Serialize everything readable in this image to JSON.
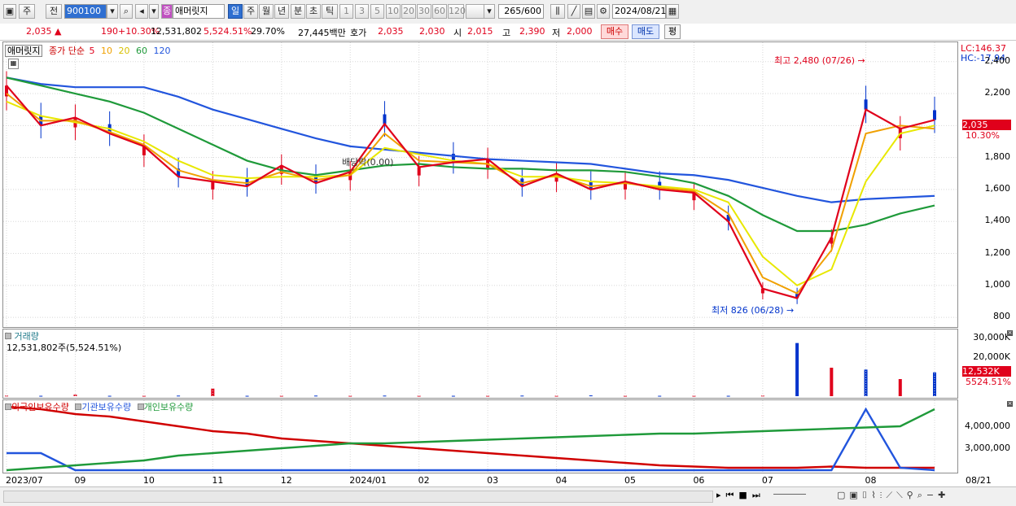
{
  "toolbar": {
    "market": "주",
    "market2": "전",
    "code": "900100",
    "stock_name": "애머릿지",
    "periods": [
      "일",
      "주",
      "월",
      "년",
      "분",
      "초",
      "틱"
    ],
    "active_period": "일",
    "minute_options": [
      "1",
      "3",
      "5",
      "10",
      "20",
      "30",
      "60",
      "120"
    ],
    "count": "265",
    "count_total": "/600",
    "date": "2024/08/21"
  },
  "quote": {
    "price": "2,035",
    "change": "190",
    "change_pct": "+10.30%",
    "volume": "12,531,802",
    "volume_pct": "5,524.51%",
    "turnover": "29.70%",
    "amount": "27,445백만",
    "ask_label": "호가",
    "ask": "2,035",
    "bid": "2,030",
    "open_label": "시",
    "open": "2,015",
    "high_label": "고",
    "high": "2,390",
    "low_label": "저",
    "low": "2,000",
    "buy_label": "매수",
    "sell_label": "매도",
    "eval_label": "평"
  },
  "price_panel": {
    "title_tag": "애머릿지",
    "ma_label": "종가 단순",
    "ma_periods": [
      "5",
      "10",
      "20",
      "60",
      "120"
    ],
    "ma_colors": [
      "#e0001b",
      "#f0a000",
      "#e8e800",
      "#1f9a3a",
      "#2255dd"
    ],
    "lc": "LC:146.37",
    "hc": "HC:-17.94",
    "high_annot": "최고 2,480 (07/26)",
    "low_annot": "최저 826 (06/28)",
    "event_annot": "배당락(0.00)",
    "last_price": "2,035",
    "last_pct": "10.30%",
    "y_ticks": [
      "2,400",
      "2,200",
      "2,000",
      "1,800",
      "1,600",
      "1,400",
      "1,200",
      "1,000",
      "800"
    ]
  },
  "volume_panel": {
    "title": "거래량",
    "value": "12,531,802주(5,524.51%)",
    "y_ticks": [
      "30,000K",
      "20,000K"
    ],
    "last_volume": "12,532K",
    "last_pct": "5524.51%"
  },
  "holding_panel": {
    "series_labels": [
      "외국인보유수량",
      "기관보유수량",
      "개인보유수량"
    ],
    "series_colors": [
      "#d00000",
      "#2255dd",
      "#1f9a3a"
    ],
    "y_ticks": [
      "4,000,000",
      "3,000,000"
    ]
  },
  "x_axis": {
    "labels": [
      "2023/07",
      "09",
      "10",
      "11",
      "12",
      "2024/01",
      "02",
      "03",
      "04",
      "05",
      "06",
      "07",
      "08"
    ],
    "end_label": "08/21"
  },
  "chart_data": {
    "type": "line",
    "title": "애머릿지",
    "ylim": [
      760,
      2480
    ],
    "series": [
      {
        "name": "5",
        "values": [
          2250,
          2000,
          2050,
          1950,
          1870,
          1680,
          1650,
          1620,
          1750,
          1640,
          1710,
          2010,
          1740,
          1770,
          1790,
          1620,
          1700,
          1600,
          1650,
          1600,
          1580,
          1400,
          980,
          920,
          1300,
          2100,
          1980,
          2035
        ]
      },
      {
        "name": "10",
        "values": [
          2200,
          2030,
          2030,
          1960,
          1880,
          1720,
          1660,
          1640,
          1710,
          1660,
          1690,
          1950,
          1780,
          1770,
          1760,
          1640,
          1690,
          1620,
          1640,
          1610,
          1590,
          1450,
          1050,
          950,
          1220,
          1950,
          2000,
          1980
        ]
      },
      {
        "name": "20",
        "values": [
          2150,
          2060,
          2020,
          1980,
          1900,
          1780,
          1690,
          1670,
          1680,
          1680,
          1690,
          1860,
          1820,
          1780,
          1760,
          1680,
          1680,
          1650,
          1640,
          1620,
          1600,
          1520,
          1180,
          1000,
          1100,
          1650,
          1950,
          2000
        ]
      },
      {
        "name": "60",
        "values": [
          2300,
          2250,
          2200,
          2150,
          2080,
          1980,
          1880,
          1780,
          1720,
          1690,
          1720,
          1750,
          1760,
          1740,
          1730,
          1730,
          1720,
          1720,
          1710,
          1680,
          1640,
          1560,
          1440,
          1340,
          1340,
          1380,
          1450,
          1500
        ]
      },
      {
        "name": "120",
        "values": [
          2300,
          2260,
          2240,
          2240,
          2240,
          2180,
          2100,
          2040,
          1980,
          1920,
          1870,
          1850,
          1830,
          1810,
          1790,
          1780,
          1770,
          1760,
          1730,
          1700,
          1690,
          1660,
          1610,
          1560,
          1520,
          1540,
          1550,
          1560
        ]
      }
    ],
    "x": [
      "2023/07",
      "",
      "09",
      "",
      "10",
      "",
      "11",
      "",
      "12",
      "",
      "2024/01",
      "",
      "02",
      "",
      "03",
      "",
      "04",
      "",
      "05",
      "",
      "06",
      "",
      "07",
      "",
      "",
      "08",
      "",
      "08/21"
    ],
    "volume_k": [
      300,
      200,
      800,
      200,
      200,
      300,
      4000,
      200,
      200,
      300,
      200,
      300,
      200,
      200,
      200,
      300,
      200,
      400,
      200,
      200,
      200,
      200,
      300,
      28000,
      15000,
      14000,
      9000,
      12532
    ],
    "holdings": {
      "foreign": [
        4900000,
        4800000,
        4600000,
        4500000,
        4300000,
        4100000,
        3900000,
        3800000,
        3600000,
        3500000,
        3400000,
        3300000,
        3200000,
        3100000,
        3000000,
        2900000,
        2800000,
        2700000,
        2600000,
        2500000,
        2450000,
        2400000,
        2400000,
        2400000,
        2450000,
        2400000,
        2400000,
        2400000
      ],
      "institution": [
        3000000,
        3000000,
        2300000,
        2300000,
        2300000,
        2300000,
        2300000,
        2300000,
        2300000,
        2300000,
        2300000,
        2300000,
        2300000,
        2300000,
        2300000,
        2300000,
        2300000,
        2300000,
        2300000,
        2300000,
        2300000,
        2300000,
        2300000,
        2300000,
        2300000,
        4800000,
        2400000,
        2300000
      ],
      "individual": [
        2300000,
        2400000,
        2500000,
        2600000,
        2700000,
        2900000,
        3000000,
        3100000,
        3200000,
        3300000,
        3400000,
        3400000,
        3450000,
        3500000,
        3550000,
        3600000,
        3650000,
        3700000,
        3750000,
        3800000,
        3800000,
        3850000,
        3900000,
        3950000,
        4000000,
        4050000,
        4100000,
        4800000
      ]
    }
  }
}
